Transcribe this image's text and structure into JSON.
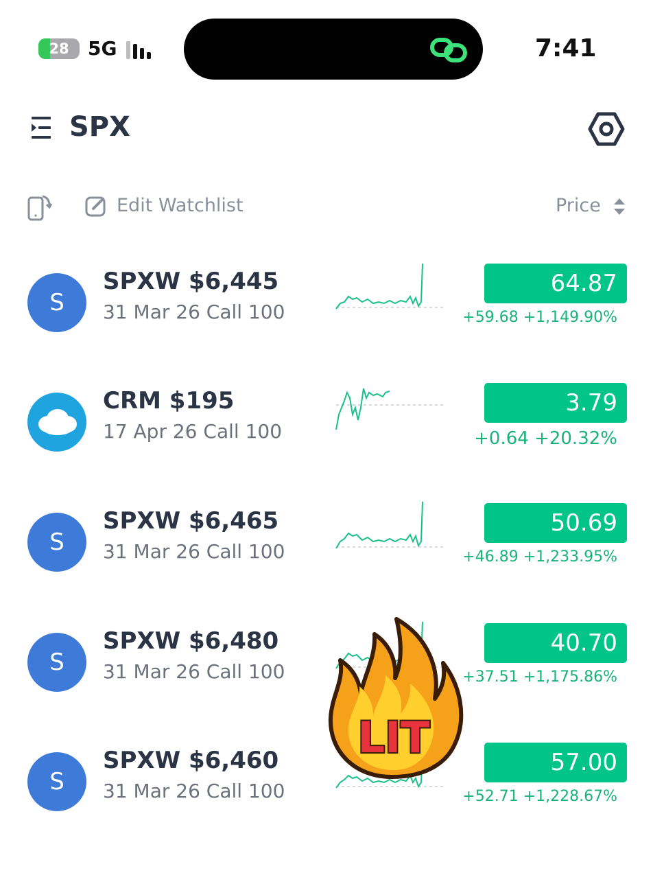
{
  "status_bar": {
    "battery": "28",
    "battery_level": 0.28,
    "network": "5G",
    "time": "7:41"
  },
  "header": {
    "title": "SPX",
    "menu_icon": "menu-collapse-icon",
    "settings_icon": "hexagon-settings-icon"
  },
  "toolbar": {
    "edit_label": "Edit Watchlist",
    "sort_label": "Price"
  },
  "colors": {
    "accent_green": "#00c488",
    "change_green": "#19b37a",
    "avatar_blue": "#3e7ad8",
    "salesforce_blue": "#20a4e0"
  },
  "rows": [
    {
      "avatar": "S",
      "title": "SPXW $6,445",
      "subtitle": "31 Mar 26 Call 100",
      "price": "64.87",
      "change": "+59.68 +1,149.90%"
    },
    {
      "avatar": "",
      "title": "CRM $195",
      "subtitle": "17 Apr 26 Call 100",
      "price": "3.79",
      "change": "+0.64 +20.32%"
    },
    {
      "avatar": "S",
      "title": "SPXW $6,465",
      "subtitle": "31 Mar 26 Call 100",
      "price": "50.69",
      "change": "+46.89 +1,233.95%"
    },
    {
      "avatar": "S",
      "title": "SPXW $6,480",
      "subtitle": "31 Mar 26 Call 100",
      "price": "40.70",
      "change": "+37.51 +1,175.86%"
    },
    {
      "avatar": "S",
      "title": "SPXW $6,460",
      "subtitle": "31 Mar 26 Call 100",
      "price": "57.00",
      "change": "+52.71 +1,228.67%"
    }
  ],
  "sticker": {
    "text": "LIT"
  }
}
